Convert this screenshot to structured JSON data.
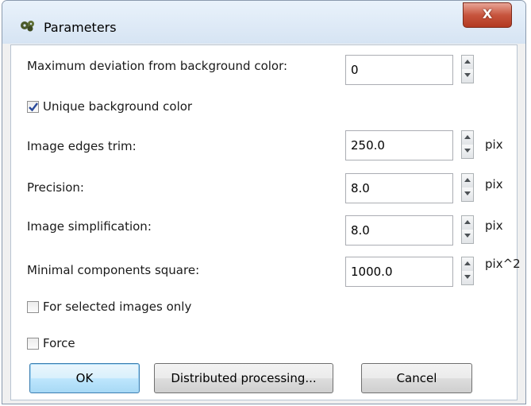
{
  "window": {
    "title": "Parameters",
    "close_label": "X"
  },
  "fields": [
    {
      "id": "max_deviation",
      "label": "Maximum deviation from background color:",
      "value": "0",
      "unit": ""
    },
    {
      "id": "edges_trim",
      "label": "Image edges trim:",
      "value": "250.0",
      "unit": "pix"
    },
    {
      "id": "precision",
      "label": "Precision:",
      "value": "8.0",
      "unit": "pix"
    },
    {
      "id": "simplification",
      "label": "Image simplification:",
      "value": "8.0",
      "unit": "pix"
    },
    {
      "id": "min_components",
      "label": "Minimal components square:",
      "value": "1000.0",
      "unit": "pix^2"
    }
  ],
  "checkboxes": [
    {
      "id": "unique_bg",
      "label": "Unique background color",
      "checked": true
    },
    {
      "id": "selected_only",
      "label": "For selected images only",
      "checked": false
    },
    {
      "id": "force",
      "label": "Force",
      "checked": false
    }
  ],
  "buttons": {
    "ok": "OK",
    "distributed": "Distributed processing...",
    "cancel": "Cancel"
  },
  "icons": {
    "app": "gear-cluster-icon",
    "close": "close-icon",
    "spin_up": "arrow-up-icon",
    "spin_down": "arrow-down-icon",
    "check": "checkmark-icon"
  }
}
